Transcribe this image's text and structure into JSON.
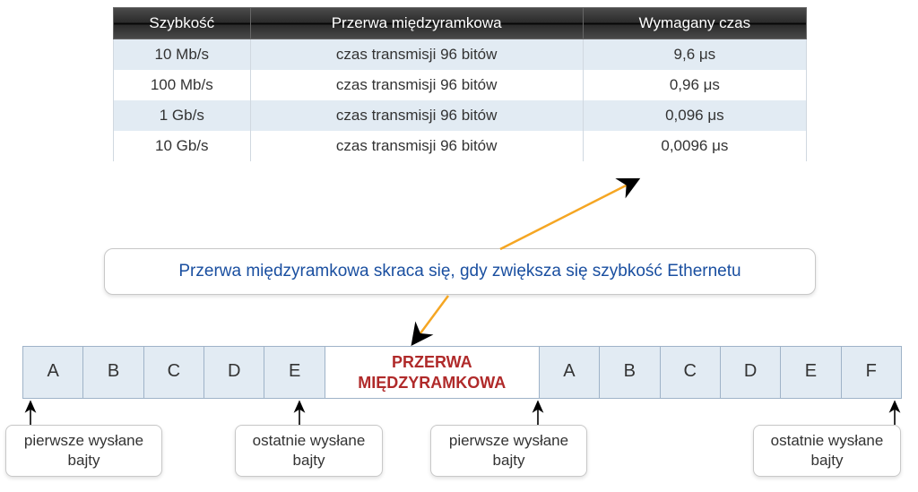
{
  "table": {
    "headers": {
      "h1": "Szybkość",
      "h2": "Przerwa międzyramkowa",
      "h3": "Wymagany czas"
    },
    "rows": [
      {
        "c1": "10 Mb/s",
        "c2": "czas transmisji 96 bitów",
        "c3": "9,6 μs"
      },
      {
        "c1": "100 Mb/s",
        "c2": "czas transmisji 96 bitów",
        "c3": "0,96 μs"
      },
      {
        "c1": "1 Gb/s",
        "c2": "czas transmisji 96 bitów",
        "c3": "0,096 μs"
      },
      {
        "c1": "10 Gb/s",
        "c2": "czas transmisji 96 bitów",
        "c3": "0,0096 μs"
      }
    ]
  },
  "callout": "Przerwa międzyramkowa skraca się, gdy zwiększa się szybkość  Ethernetu",
  "frames": {
    "left": [
      "A",
      "B",
      "C",
      "D",
      "E"
    ],
    "gap_l1": "PRZERWA",
    "gap_l2": "MIĘDZYRAMKOWA",
    "right": [
      "A",
      "B",
      "C",
      "D",
      "E",
      "F"
    ]
  },
  "labels": {
    "first_sent_l1": "pierwsze wysłane",
    "first_sent_l2": "bajty",
    "last_sent_l1": "ostatnie wysłane",
    "last_sent_l2": "bajty"
  }
}
